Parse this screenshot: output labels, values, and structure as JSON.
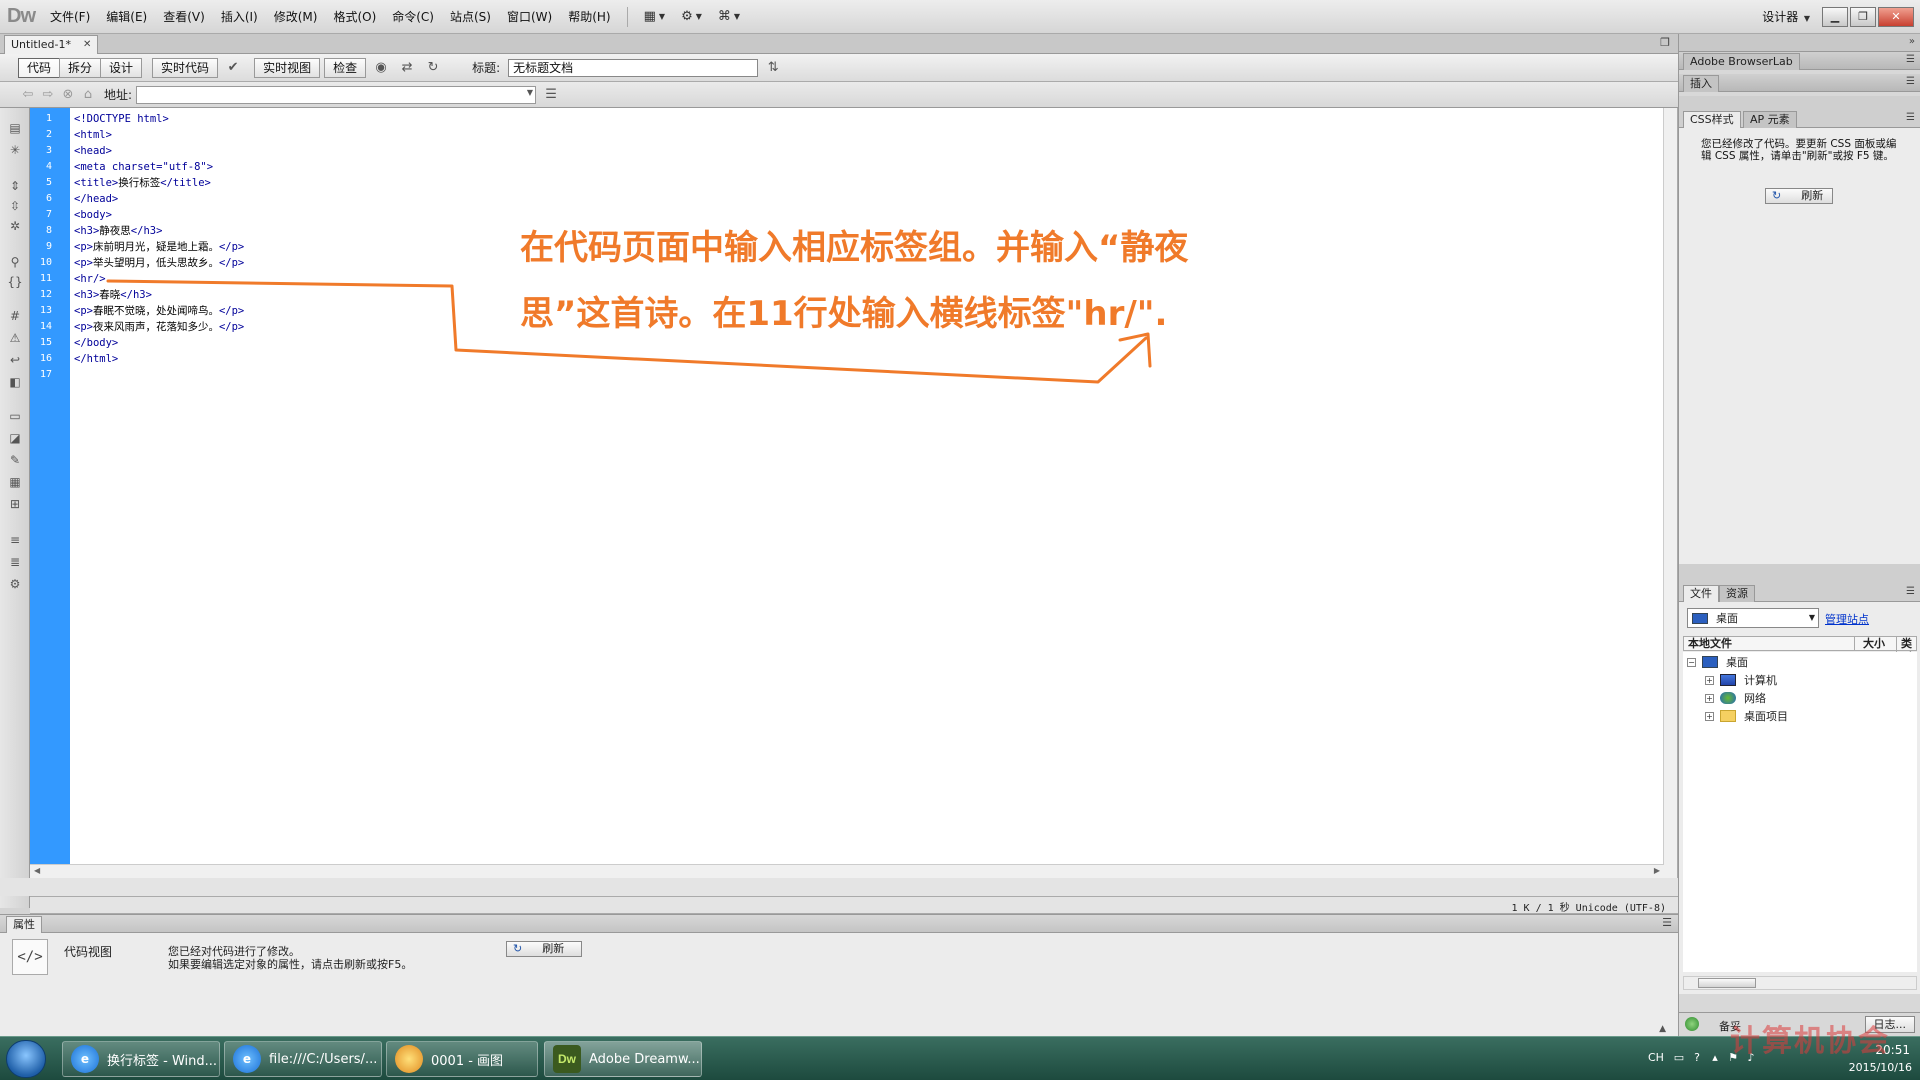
{
  "app": {
    "logo": "Dw",
    "menus": [
      "文件(F)",
      "编辑(E)",
      "查看(V)",
      "插入(I)",
      "修改(M)",
      "格式(O)",
      "命令(C)",
      "站点(S)",
      "窗口(W)",
      "帮助(H)"
    ],
    "workspace": "设计器",
    "window_buttons": [
      "minimize",
      "restore",
      "close"
    ]
  },
  "document": {
    "tab_label": "Untitled-1*",
    "views": [
      "代码",
      "拆分",
      "设计"
    ],
    "active_view": "代码",
    "live_code_label": "实时代码",
    "live_view_label": "实时视图",
    "inspect_label": "检查",
    "title_label": "标题:",
    "title_value": "无标题文档",
    "address_label": "地址:",
    "address_value": ""
  },
  "code": {
    "lines": [
      {
        "n": "1",
        "tag1": "<!DOCTYPE html>",
        "text": "",
        "tag2": ""
      },
      {
        "n": "2",
        "tag1": "<html>",
        "text": "",
        "tag2": ""
      },
      {
        "n": "3",
        "tag1": "<head>",
        "text": "",
        "tag2": ""
      },
      {
        "n": "4",
        "tag1": "<meta charset=\"utf-8\">",
        "text": "",
        "tag2": ""
      },
      {
        "n": "5",
        "tag1": "<title>",
        "text": "换行标签",
        "tag2": "</title>"
      },
      {
        "n": "6",
        "tag1": "</head>",
        "text": "",
        "tag2": ""
      },
      {
        "n": "7",
        "tag1": "<body>",
        "text": "",
        "tag2": ""
      },
      {
        "n": "8",
        "tag1": "<h3>",
        "text": "静夜思",
        "tag2": "</h3>"
      },
      {
        "n": "9",
        "tag1": "<p>",
        "text": "床前明月光，疑是地上霜。",
        "tag2": "</p>"
      },
      {
        "n": "10",
        "tag1": "<p>",
        "text": "举头望明月，低头思故乡。",
        "tag2": "</p>"
      },
      {
        "n": "11",
        "tag1": "<hr/>",
        "text": "",
        "tag2": ""
      },
      {
        "n": "12",
        "tag1": "<h3>",
        "text": "春晓",
        "tag2": "</h3>"
      },
      {
        "n": "13",
        "tag1": "<p>",
        "text": "春眠不觉晓，处处闻啼鸟。",
        "tag2": "</p>"
      },
      {
        "n": "14",
        "tag1": "<p>",
        "text": "夜来风雨声，花落知多少。",
        "tag2": "</p>"
      },
      {
        "n": "15",
        "tag1": "</body>",
        "text": "",
        "tag2": ""
      },
      {
        "n": "16",
        "tag1": "</html>",
        "text": "",
        "tag2": ""
      },
      {
        "n": "17",
        "tag1": "",
        "text": "",
        "tag2": ""
      }
    ]
  },
  "annotation": {
    "line1": "在代码页面中输入相应标签组。并输入“静夜",
    "line2": "思”这首诗。在11行处输入横线标签\"hr/\".",
    "color": "#f07a2a"
  },
  "status": {
    "text": "1 K / 1 秒  Unicode (UTF-8)"
  },
  "properties": {
    "tab_label": "属性",
    "view_label": "代码视图",
    "message_line1": "您已经对代码进行了修改。",
    "message_line2": "如果要编辑选定对象的属性，请点击刷新或按F5。",
    "refresh_label": "刷新"
  },
  "right_panel": {
    "browserlab_label": "Adobe BrowserLab",
    "insert_label": "插入",
    "css_tab": "CSS样式",
    "ap_tab": "AP 元素",
    "css_message": "您已经修改了代码。要更新 CSS 面板或编辑 CSS 属性，请单击\"刷新\"或按 F5 键。",
    "css_refresh_label": "刷新",
    "files_tab": "文件",
    "assets_tab": "资源",
    "site_select": "桌面",
    "manage_site": "管理站点",
    "col_local": "本地文件",
    "col_size": "大小",
    "col_type": "类型",
    "tree": [
      {
        "label": "桌面",
        "icon": "desktop-icon",
        "level": 0,
        "expander": "−"
      },
      {
        "label": "计算机",
        "icon": "computer-icon",
        "level": 1,
        "expander": "+"
      },
      {
        "label": "网络",
        "icon": "network-icon",
        "level": 1,
        "expander": "+"
      },
      {
        "label": "桌面项目",
        "icon": "folder-icon",
        "level": 1,
        "expander": "+"
      }
    ],
    "ready_label": "备妥",
    "log_label": "日志..."
  },
  "taskbar": {
    "items": [
      {
        "label": "换行标签 - Wind...",
        "icon": "ie-icon"
      },
      {
        "label": "file:///C:/Users/...",
        "icon": "ie-icon"
      },
      {
        "label": "0001 - 画图",
        "icon": "paint-icon"
      },
      {
        "label": "Adobe Dreamw...",
        "icon": "dreamweaver-icon"
      }
    ],
    "input_lang": "CH",
    "time": "20:51",
    "date": "2015/10/16",
    "watermark": "计算机协会"
  }
}
